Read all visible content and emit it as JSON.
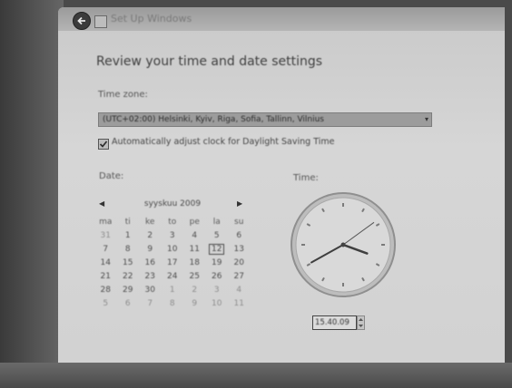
{
  "window": {
    "title": "Set Up Windows"
  },
  "page": {
    "heading": "Review your time and date settings",
    "time_zone_label": "Time zone:",
    "time_zone_value": "(UTC+02:00) Helsinki, Kyiv, Riga, Sofia, Tallinn, Vilnius",
    "dst_label": "Automatically adjust clock for Daylight Saving Time",
    "dst_checked": true,
    "date_label": "Date:",
    "time_label": "Time:"
  },
  "calendar": {
    "month_label": "syyskuu 2009",
    "weekdays": [
      "ma",
      "ti",
      "ke",
      "to",
      "pe",
      "la",
      "su"
    ],
    "weeks": [
      [
        {
          "d": "31",
          "o": true
        },
        {
          "d": "1"
        },
        {
          "d": "2"
        },
        {
          "d": "3"
        },
        {
          "d": "4"
        },
        {
          "d": "5"
        },
        {
          "d": "6"
        }
      ],
      [
        {
          "d": "7"
        },
        {
          "d": "8"
        },
        {
          "d": "9"
        },
        {
          "d": "10"
        },
        {
          "d": "11"
        },
        {
          "d": "12",
          "sel": true
        },
        {
          "d": "13"
        }
      ],
      [
        {
          "d": "14"
        },
        {
          "d": "15"
        },
        {
          "d": "16"
        },
        {
          "d": "17"
        },
        {
          "d": "18"
        },
        {
          "d": "19"
        },
        {
          "d": "20"
        }
      ],
      [
        {
          "d": "21"
        },
        {
          "d": "22"
        },
        {
          "d": "23"
        },
        {
          "d": "24"
        },
        {
          "d": "25"
        },
        {
          "d": "26"
        },
        {
          "d": "27"
        }
      ],
      [
        {
          "d": "28"
        },
        {
          "d": "29"
        },
        {
          "d": "30"
        },
        {
          "d": "1",
          "o": true
        },
        {
          "d": "2",
          "o": true
        },
        {
          "d": "3",
          "o": true
        },
        {
          "d": "4",
          "o": true
        }
      ],
      [
        {
          "d": "5",
          "o": true
        },
        {
          "d": "6",
          "o": true
        },
        {
          "d": "7",
          "o": true
        },
        {
          "d": "8",
          "o": true
        },
        {
          "d": "9",
          "o": true
        },
        {
          "d": "10",
          "o": true
        },
        {
          "d": "11",
          "o": true
        }
      ]
    ]
  },
  "clock": {
    "time_value": "15.40.09",
    "hours": 15,
    "minutes": 40,
    "seconds": 9
  },
  "icons": {
    "back": "back-arrow-icon",
    "wizard": "setup-wizard-icon",
    "dropdown": "chevron-down-icon",
    "checkbox": "checkmark-icon",
    "prev": "triangle-left-icon",
    "next": "triangle-right-icon"
  }
}
